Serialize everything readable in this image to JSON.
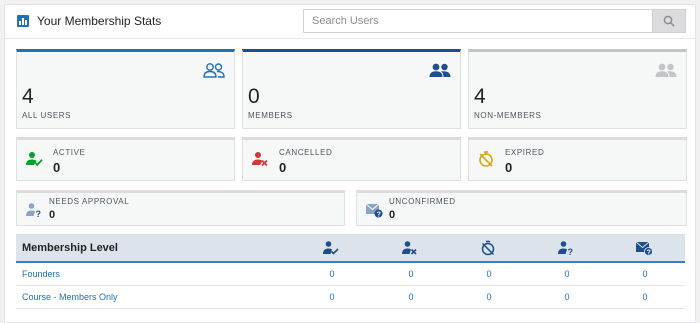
{
  "header": {
    "title": "Your Membership Stats",
    "search_placeholder": "Search Users"
  },
  "summary": [
    {
      "value": "4",
      "label": "ALL USERS",
      "color": "#2271b1",
      "icon": "users-outline-icon"
    },
    {
      "value": "0",
      "label": "MEMBERS",
      "color": "#1e4e8c",
      "icon": "users-solid-icon"
    },
    {
      "value": "4",
      "label": "NON-MEMBERS",
      "color": "#c3c4c7",
      "icon": "users-grey-icon"
    }
  ],
  "statuses": [
    {
      "label": "ACTIVE",
      "value": "0",
      "color": "#00a32a",
      "icon": "user-check-icon"
    },
    {
      "label": "CANCELLED",
      "value": "0",
      "color": "#d63638",
      "icon": "user-x-icon"
    },
    {
      "label": "EXPIRED",
      "value": "0",
      "color": "#dba617",
      "icon": "timer-off-icon"
    }
  ],
  "pending": [
    {
      "label": "NEEDS APPROVAL",
      "value": "0",
      "icon": "user-question-icon"
    },
    {
      "label": "UNCONFIRMED",
      "value": "0",
      "icon": "mail-question-icon"
    }
  ],
  "table": {
    "header_label": "Membership Level",
    "columns": [
      "active-icon",
      "cancelled-icon",
      "expired-icon",
      "needs-approval-icon",
      "unconfirmed-icon"
    ],
    "rows": [
      {
        "name": "Founders",
        "values": [
          "0",
          "0",
          "0",
          "0",
          "0"
        ]
      },
      {
        "name": "Course - Members Only",
        "values": [
          "0",
          "0",
          "0",
          "0",
          "0"
        ]
      }
    ]
  },
  "colors": {
    "accent": "#2271b1",
    "muted_icon": "#8aa4c4"
  }
}
